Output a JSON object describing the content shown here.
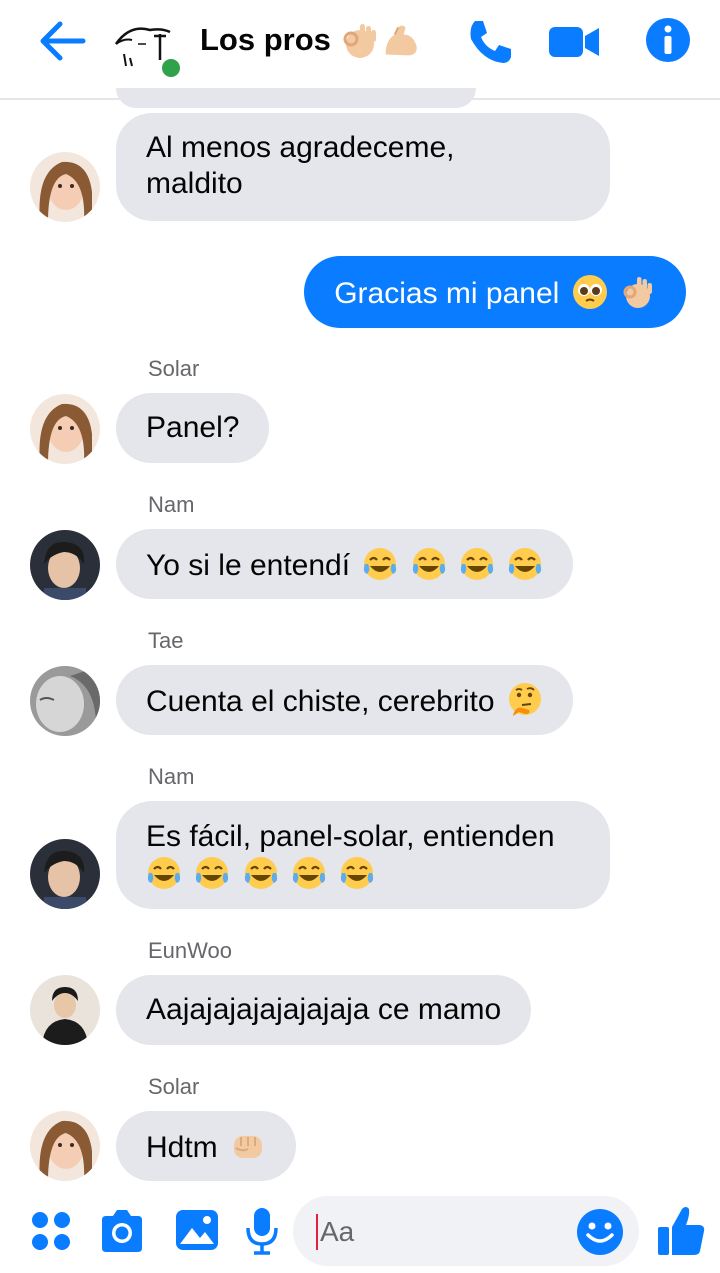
{
  "header": {
    "title": "Los pros",
    "title_emojis": [
      "ok-hand-emoji",
      "flexed-biceps-emoji"
    ],
    "icons": [
      "back-arrow-icon",
      "phone-icon",
      "video-camera-icon",
      "info-icon"
    ],
    "accent_color": "#0a7cff",
    "online_color": "#31a24c"
  },
  "messages": [
    {
      "sender": "",
      "text": "Al menos agradeceme,\nmaldito",
      "avatar": "solar-avatar",
      "direction": "incoming"
    },
    {
      "sender": "",
      "text": "Gracias mi panel",
      "emojis": [
        "pleading-face-emoji",
        "ok-hand-emoji"
      ],
      "direction": "outgoing"
    },
    {
      "sender": "Solar",
      "text": "Panel?",
      "avatar": "solar-avatar",
      "direction": "incoming"
    },
    {
      "sender": "Nam",
      "text": "Yo si le entendí",
      "emojis": [
        "tears-of-joy-emoji",
        "tears-of-joy-emoji",
        "tears-of-joy-emoji",
        "tears-of-joy-emoji"
      ],
      "avatar": "nam-avatar",
      "direction": "incoming"
    },
    {
      "sender": "Tae",
      "text": "Cuenta el chiste, cerebrito",
      "emojis": [
        "thinking-face-emoji"
      ],
      "avatar": "tae-avatar",
      "direction": "incoming"
    },
    {
      "sender": "Nam",
      "text": "Es fácil, panel-solar, entienden",
      "emojis": [
        "tears-of-joy-emoji",
        "tears-of-joy-emoji",
        "tears-of-joy-emoji",
        "tears-of-joy-emoji",
        "tears-of-joy-emoji"
      ],
      "avatar": "nam-avatar",
      "direction": "incoming"
    },
    {
      "sender": "EunWoo",
      "text": "Aajajajajajajajaja ce mamo",
      "avatar": "eunwoo-avatar",
      "direction": "incoming"
    },
    {
      "sender": "Solar",
      "text": "Hdtm",
      "emojis": [
        "fist-emoji"
      ],
      "avatar": "solar-avatar",
      "direction": "incoming"
    }
  ],
  "composer": {
    "placeholder": "Aa",
    "icons": [
      "menu-dots-icon",
      "camera-icon",
      "image-icon",
      "microphone-icon",
      "smiley-icon",
      "thumbs-up-icon"
    ]
  }
}
